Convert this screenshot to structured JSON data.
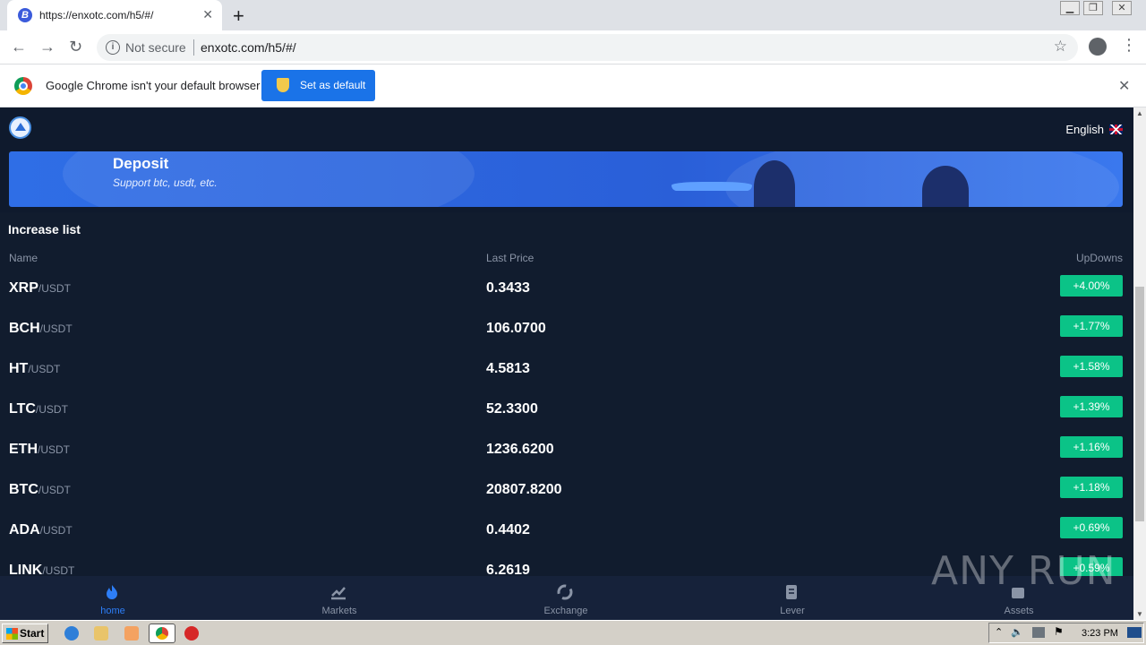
{
  "browser": {
    "tab_title": "https://enxotc.com/h5/#/",
    "tab_favicon": "B",
    "new_tab": "+",
    "security_label": "Not secure",
    "url": "enxotc.com/h5/#/",
    "infobar_text": "Google Chrome isn't your default browser",
    "set_default_label": "Set as default"
  },
  "header": {
    "language": "English"
  },
  "banner": {
    "title": "Deposit",
    "subtitle": "Support btc, usdt, etc."
  },
  "list": {
    "title": "Increase list",
    "col_name": "Name",
    "col_price": "Last Price",
    "col_change": "UpDowns",
    "rows": [
      {
        "base": "XRP",
        "quote": "/USDT",
        "price": "0.3433",
        "change": "+4.00%"
      },
      {
        "base": "BCH",
        "quote": "/USDT",
        "price": "106.0700",
        "change": "+1.77%"
      },
      {
        "base": "HT",
        "quote": "/USDT",
        "price": "4.5813",
        "change": "+1.58%"
      },
      {
        "base": "LTC",
        "quote": "/USDT",
        "price": "52.3300",
        "change": "+1.39%"
      },
      {
        "base": "ETH",
        "quote": "/USDT",
        "price": "1236.6200",
        "change": "+1.16%"
      },
      {
        "base": "BTC",
        "quote": "/USDT",
        "price": "20807.8200",
        "change": "+1.18%"
      },
      {
        "base": "ADA",
        "quote": "/USDT",
        "price": "0.4402",
        "change": "+0.69%"
      },
      {
        "base": "LINK",
        "quote": "/USDT",
        "price": "6.2619",
        "change": "+0.59%"
      }
    ]
  },
  "tabbar": {
    "home": "home",
    "markets": "Markets",
    "exchange": "Exchange",
    "lever": "Lever",
    "assets": "Assets"
  },
  "watermark": "ANY RUN",
  "taskbar": {
    "start": "Start",
    "clock": "3:23 PM"
  },
  "colors": {
    "page_bg": "#0f1a2d",
    "accent": "#2d7ef7",
    "up_badge": "#0bc387",
    "banner": "#2f6ee6"
  }
}
